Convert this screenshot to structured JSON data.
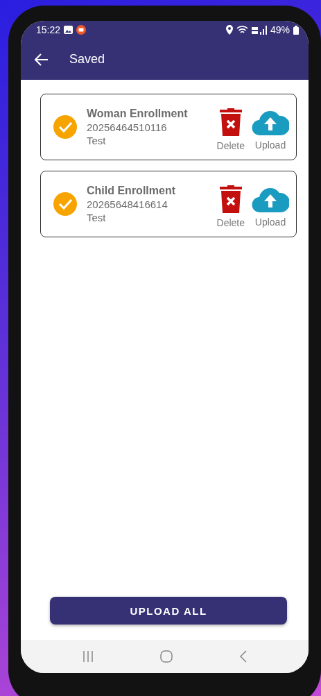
{
  "status_bar": {
    "time": "15:22",
    "battery": "49%"
  },
  "app_bar": {
    "title": "Saved"
  },
  "records": [
    {
      "title": "Woman Enrollment",
      "number": "20256464510116",
      "note": "Test",
      "checked": true,
      "delete_label": "Delete",
      "upload_label": "Upload"
    },
    {
      "title": "Child Enrollment",
      "number": "20265648416614",
      "note": "Test",
      "checked": true,
      "delete_label": "Delete",
      "upload_label": "Upload"
    }
  ],
  "upload_all": {
    "label": "UPLOAD ALL"
  }
}
